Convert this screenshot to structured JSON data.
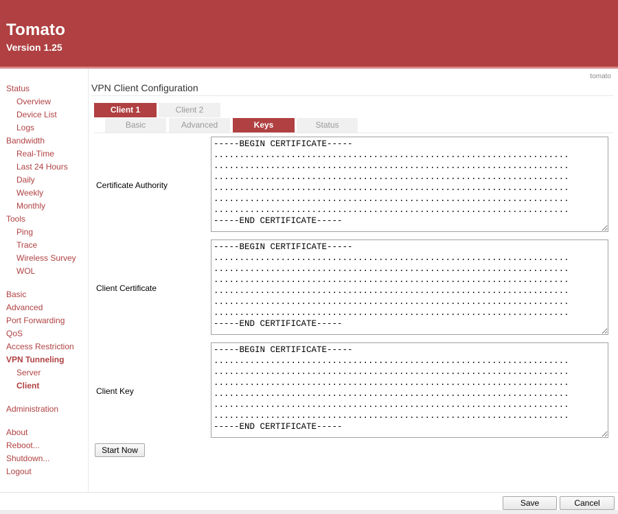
{
  "header": {
    "title": "Tomato",
    "version": "Version 1.25"
  },
  "user": "tomato",
  "sidebar": [
    {
      "label": "Status",
      "sub": false,
      "bold": false
    },
    {
      "label": "Overview",
      "sub": true,
      "bold": false
    },
    {
      "label": "Device List",
      "sub": true,
      "bold": false
    },
    {
      "label": "Logs",
      "sub": true,
      "bold": false
    },
    {
      "label": "Bandwidth",
      "sub": false,
      "bold": false
    },
    {
      "label": "Real-Time",
      "sub": true,
      "bold": false
    },
    {
      "label": "Last 24 Hours",
      "sub": true,
      "bold": false
    },
    {
      "label": "Daily",
      "sub": true,
      "bold": false
    },
    {
      "label": "Weekly",
      "sub": true,
      "bold": false
    },
    {
      "label": "Monthly",
      "sub": true,
      "bold": false
    },
    {
      "label": "Tools",
      "sub": false,
      "bold": false
    },
    {
      "label": "Ping",
      "sub": true,
      "bold": false
    },
    {
      "label": "Trace",
      "sub": true,
      "bold": false
    },
    {
      "label": "Wireless Survey",
      "sub": true,
      "bold": false
    },
    {
      "label": "WOL",
      "sub": true,
      "bold": false
    },
    {
      "label": "Basic",
      "sub": false,
      "bold": false
    },
    {
      "label": "Advanced",
      "sub": false,
      "bold": false
    },
    {
      "label": "Port Forwarding",
      "sub": false,
      "bold": false
    },
    {
      "label": "QoS",
      "sub": false,
      "bold": false
    },
    {
      "label": "Access Restriction",
      "sub": false,
      "bold": false
    },
    {
      "label": "VPN Tunneling",
      "sub": false,
      "bold": true
    },
    {
      "label": "Server",
      "sub": true,
      "bold": false
    },
    {
      "label": "Client",
      "sub": true,
      "bold": true
    },
    {
      "label": "Administration",
      "sub": false,
      "bold": false
    },
    {
      "label": "About",
      "sub": false,
      "bold": false
    },
    {
      "label": "Reboot...",
      "sub": false,
      "bold": false
    },
    {
      "label": "Shutdown...",
      "sub": false,
      "bold": false
    },
    {
      "label": "Logout",
      "sub": false,
      "bold": false
    }
  ],
  "page_title": "VPN Client Configuration",
  "client_tabs": [
    {
      "label": "Client 1",
      "active": true
    },
    {
      "label": "Client 2",
      "active": false
    }
  ],
  "section_tabs": [
    {
      "label": "Basic",
      "active": false
    },
    {
      "label": "Advanced",
      "active": false
    },
    {
      "label": "Keys",
      "active": true
    },
    {
      "label": "Status",
      "active": false
    }
  ],
  "fields": [
    {
      "label": "Certificate Authority",
      "value": "-----BEGIN CERTIFICATE-----\n.....................................................................\n.....................................................................\n.....................................................................\n.....................................................................\n.....................................................................\n.....................................................................\n-----END CERTIFICATE-----"
    },
    {
      "label": "Client Certificate",
      "value": "-----BEGIN CERTIFICATE-----\n.....................................................................\n.....................................................................\n.....................................................................\n.....................................................................\n.....................................................................\n.....................................................................\n-----END CERTIFICATE-----"
    },
    {
      "label": "Client Key",
      "value": "-----BEGIN CERTIFICATE-----\n.....................................................................\n.....................................................................\n.....................................................................\n.....................................................................\n.....................................................................\n.....................................................................\n-----END CERTIFICATE-----"
    }
  ],
  "buttons": {
    "start_now": "Start Now",
    "save": "Save",
    "cancel": "Cancel"
  },
  "colors": {
    "accent": "#b04041",
    "tab_inactive": "#f0f0f0",
    "link": "#b04041"
  }
}
